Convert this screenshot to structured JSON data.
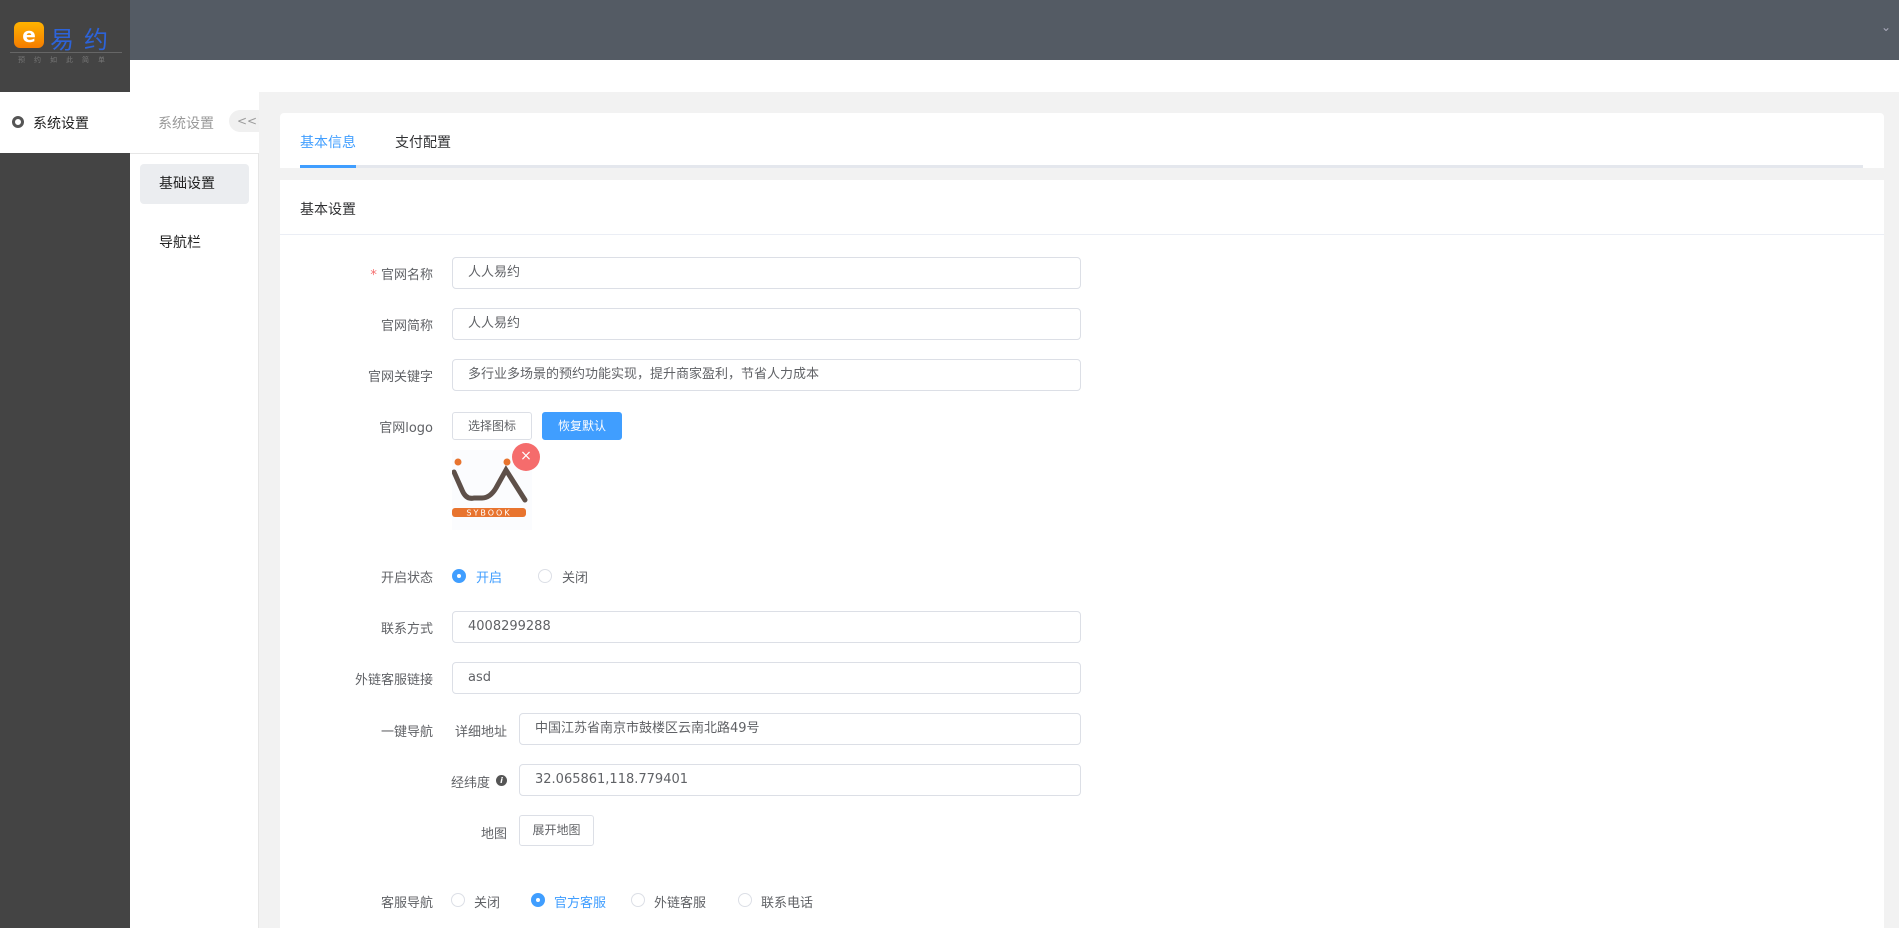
{
  "brand": {
    "logo_mark": "e",
    "name": "易约",
    "slogan": "预约如此简单"
  },
  "header": {
    "dropdown_icon": "chevron-down-icon"
  },
  "sidebar": {
    "active_item": "系统设置",
    "icon": "gear-icon"
  },
  "subnav": {
    "title": "系统设置",
    "collapse": "<<",
    "items": [
      {
        "label": "基础设置",
        "active": true
      },
      {
        "label": "导航栏",
        "active": false
      }
    ]
  },
  "tabs": [
    {
      "label": "基本信息",
      "active": true
    },
    {
      "label": "支付配置",
      "active": false
    }
  ],
  "section_title": "基本设置",
  "form": {
    "site_name": {
      "label": "官网名称",
      "required": true,
      "value": "人人易约"
    },
    "site_short": {
      "label": "官网简称",
      "value": "人人易约"
    },
    "keywords": {
      "label": "官网关键字",
      "value": "多行业多场景的预约功能实现，提升商家盈利，节省人力成本"
    },
    "logo": {
      "label": "官网logo",
      "choose": "选择图标",
      "reset": "恢复默认",
      "image_text": "EASYBOOK"
    },
    "status": {
      "label": "开启状态",
      "options": [
        "开启",
        "关闭"
      ],
      "selected": "开启"
    },
    "contact": {
      "label": "联系方式",
      "value": "4008299288"
    },
    "service_link": {
      "label": "外链客服链接",
      "value": "asd"
    },
    "navigation": {
      "label": "一键导航",
      "address_label": "详细地址",
      "address": "中国江苏省南京市鼓楼区云南北路49号",
      "latlng_label": "经纬度",
      "latlng": "32.065861,118.779401",
      "map_label": "地图",
      "map_button": "展开地图"
    },
    "service_nav": {
      "label": "客服导航",
      "options": [
        "关闭",
        "官方客服",
        "外链客服",
        "联系电话"
      ],
      "selected": "官方客服"
    }
  },
  "colors": {
    "primary": "#409eff",
    "danger": "#f56c6c",
    "header": "#545b64",
    "sidebar": "#444444"
  }
}
